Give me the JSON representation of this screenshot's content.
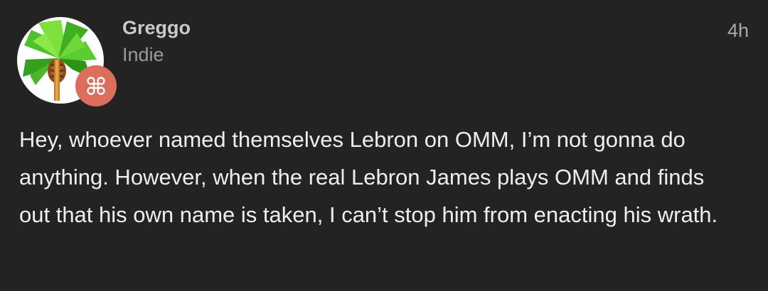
{
  "post": {
    "author": {
      "name": "Greggo",
      "tag": "Indie",
      "avatar_icon": "palm-tree-guitar-icon",
      "badge_icon": "command-key-icon",
      "badge_color": "#dd6e5c"
    },
    "timestamp": "4h",
    "body": "Hey, whoever named themselves Lebron on OMM, I’m not gonna do anything. However, when the real Lebron James plays OMM and finds out that his own name is taken, I can’t stop him from enacting his wrath."
  },
  "colors": {
    "background": "#232323",
    "text": "#eeeeee",
    "muted": "#9a9a9a"
  }
}
